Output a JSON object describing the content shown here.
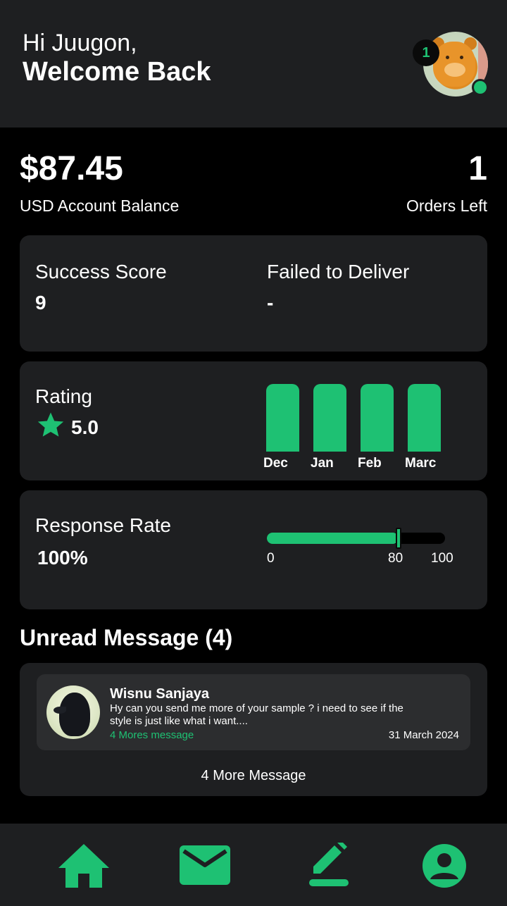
{
  "header": {
    "greeting": "Hi Juugon,",
    "welcome": "Welcome Back",
    "notification_count": "1",
    "avatar_icon": "bear-avatar",
    "online_status_color": "#1ec173"
  },
  "account": {
    "balance": "$87.45",
    "balance_label": "USD Account Balance",
    "orders_left": "1",
    "orders_label": "Orders Left"
  },
  "stats": {
    "success_label": "Success Score",
    "success_value": "9",
    "failed_label": "Failed to Deliver",
    "failed_value": "-"
  },
  "rating": {
    "label": "Rating",
    "value": "5.0",
    "icon": "star-icon",
    "months": [
      "Dec",
      "Jan",
      "Feb",
      "Marc"
    ]
  },
  "response": {
    "label": "Response Rate",
    "value": "100%",
    "slider_level_percent": 74,
    "ticks": [
      "0",
      "80",
      "100"
    ]
  },
  "messages": {
    "title": "Unread Message (4)",
    "items": [
      {
        "name": "Wisnu Sanjaya",
        "text": "Hy can you send me more of your sample ? i need to see if the style is just like what i want....",
        "more": "4 Mores message",
        "date": "31 March 2024"
      }
    ],
    "more_button": "4 More Message"
  },
  "nav": {
    "items": [
      "home-icon",
      "mail-icon",
      "edit-icon",
      "profile-icon"
    ]
  },
  "colors": {
    "accent": "#1ec173",
    "card": "#1e1f21",
    "background": "#000000"
  }
}
